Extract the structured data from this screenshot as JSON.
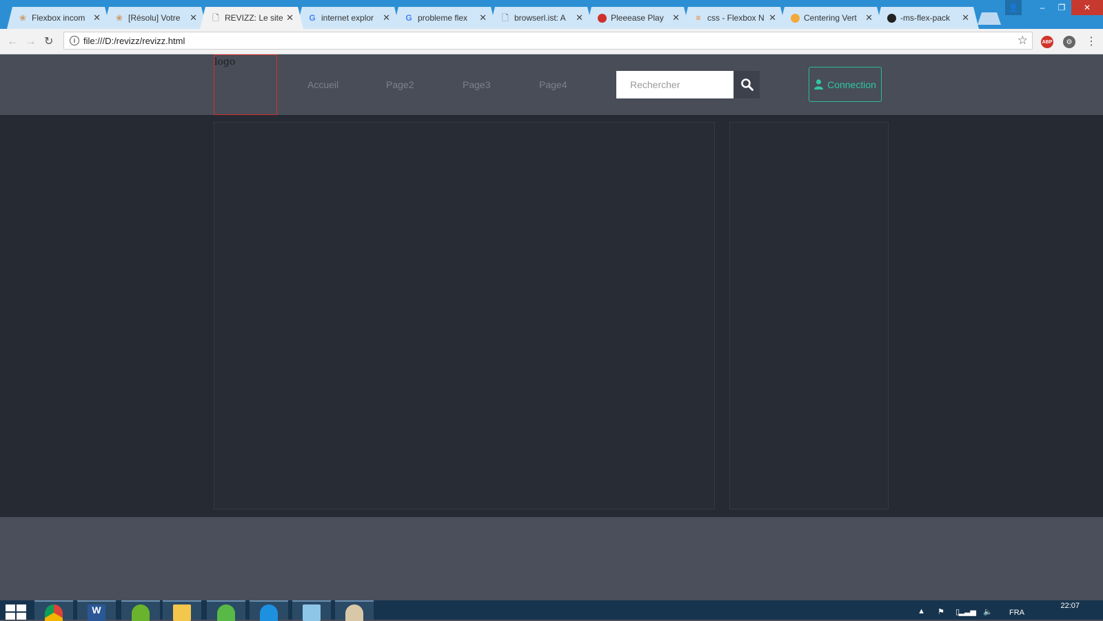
{
  "browser": {
    "tabs": [
      {
        "label": "Flexbox incom",
        "icon": "openclassrooms-icon",
        "active": false
      },
      {
        "label": "[Résolu] Votre",
        "icon": "openclassrooms-icon",
        "active": false
      },
      {
        "label": "REVIZZ: Le site",
        "icon": "page-icon",
        "active": true
      },
      {
        "label": "internet explor",
        "icon": "google-icon",
        "active": false
      },
      {
        "label": "probleme flex",
        "icon": "google-icon",
        "active": false
      },
      {
        "label": "browserl.ist: A",
        "icon": "page-icon",
        "active": false
      },
      {
        "label": "Pleeease Play",
        "icon": "red-dot-icon",
        "active": false
      },
      {
        "label": "css - Flexbox N",
        "icon": "stackoverflow-icon",
        "active": false
      },
      {
        "label": "Centering Vert",
        "icon": "css-tricks-icon",
        "active": false
      },
      {
        "label": "-ms-flex-pack",
        "icon": "github-icon",
        "active": false
      }
    ],
    "url": "file:///D:/revizz/revizz.html",
    "extensions": {
      "abp": "ABP"
    }
  },
  "site": {
    "logo_text": "logo",
    "nav": [
      "Accueil",
      "Page2",
      "Page3",
      "Page4"
    ],
    "search_placeholder": "Rechercher",
    "connect_label": "Connection",
    "accent_color": "#30c7a4"
  },
  "taskbar": {
    "apps": [
      "chrome",
      "word",
      "utorrent",
      "file-explorer",
      "spotify-like",
      "internet-explorer",
      "notepad",
      "paint"
    ],
    "language": "FRA",
    "time": "22:07"
  }
}
